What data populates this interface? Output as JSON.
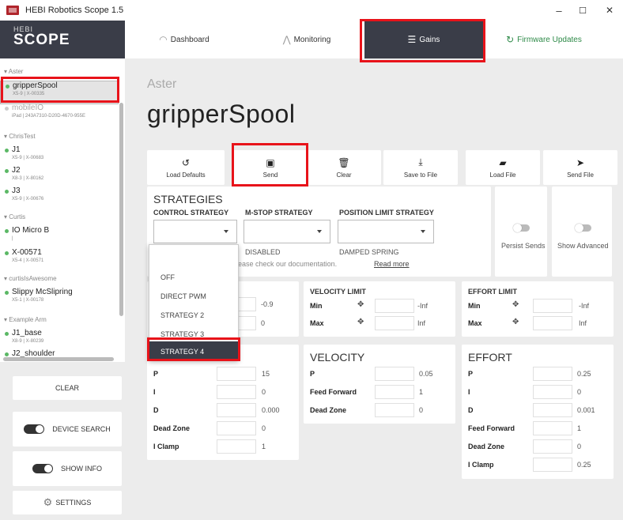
{
  "window": {
    "title": "HEBI Robotics Scope 1.5",
    "minimize": "–",
    "maximize": "☐",
    "close": "✕"
  },
  "brand": {
    "small": "HEBI",
    "big": "SCOPE"
  },
  "sidebar": {
    "groups": [
      {
        "name": "Aster"
      },
      {
        "name": "ChrisTest"
      },
      {
        "name": "Curtis"
      },
      {
        "name": "curtisIsAwesome"
      },
      {
        "name": "Example Arm"
      }
    ],
    "devices": [
      {
        "name": "gripperSpool",
        "sub": "X5-9 | X-00335"
      },
      {
        "name": "mobileIO",
        "sub": "iPad | 243A7310-D20D-4670-955E"
      },
      {
        "name": "J1",
        "sub": "X5-9 | X-00683"
      },
      {
        "name": "J2",
        "sub": "X8-3 | X-80162"
      },
      {
        "name": "J3",
        "sub": "X5-9 | X-00676"
      },
      {
        "name": "IO Micro B",
        "sub": "|"
      },
      {
        "name": "X-00571",
        "sub": "X5-4 | X-00571"
      },
      {
        "name": "Slippy McSlipring",
        "sub": "X5-1 | X-00178"
      },
      {
        "name": "J1_base",
        "sub": "X8-9 | X-80239"
      },
      {
        "name": "J2_shoulder",
        "sub": ""
      }
    ],
    "clear": "CLEAR",
    "device_search": "DEVICE SEARCH",
    "show_info": "SHOW INFO",
    "settings": "SETTINGS"
  },
  "nav": {
    "dashboard": "Dashboard",
    "monitoring": "Monitoring",
    "gains": "Gains",
    "firmware": "Firmware Updates"
  },
  "device": {
    "group": "Aster",
    "name": "gripperSpool"
  },
  "toolbar": {
    "load_defaults": "Load Defaults",
    "send": "Send",
    "clear": "Clear",
    "save": "Save to File",
    "load": "Load File",
    "send_file": "Send File"
  },
  "strategies": {
    "title": "STRATEGIES",
    "control": "CONTROL STRATEGY",
    "mstop": "M-STOP STRATEGY",
    "poslimit": "POSITION LIMIT STRATEGY",
    "mstop_value": "DISABLED",
    "poslimit_value": "DAMPED SPRING",
    "info_prefix": "n, please check our documentation.",
    "read_more": "Read more",
    "persist": "Persist Sends",
    "advanced": "Show Advanced"
  },
  "dropdown": {
    "options": [
      "OFF",
      "DIRECT PWM",
      "STRATEGY 2",
      "STRATEGY 3",
      "STRATEGY 4"
    ]
  },
  "limits": {
    "pos_min": "-0.9",
    "pos_max": "0",
    "vel_title": "VELOCITY LIMIT",
    "eff_title": "EFFORT LIMIT",
    "min": "Min",
    "max": "Max",
    "vel_min": "-Inf",
    "vel_max": "Inf",
    "eff_min": "-Inf",
    "eff_max": "Inf"
  },
  "gains": {
    "vel_title": "VELOCITY",
    "eff_title": "EFFORT",
    "labels": {
      "p": "P",
      "i": "I",
      "d": "D",
      "dz": "Dead Zone",
      "ic": "I Clamp",
      "ff": "Feed Forward"
    },
    "pos": {
      "p": "15",
      "i": "0",
      "d": "0.000",
      "dz": "0",
      "ic": "1"
    },
    "vel": {
      "p": "0.05",
      "ff": "1",
      "dz": "0"
    },
    "eff": {
      "p": "0.25",
      "i": "0",
      "d": "0.001",
      "ff": "1",
      "dz": "0",
      "ic": "0.25"
    }
  }
}
